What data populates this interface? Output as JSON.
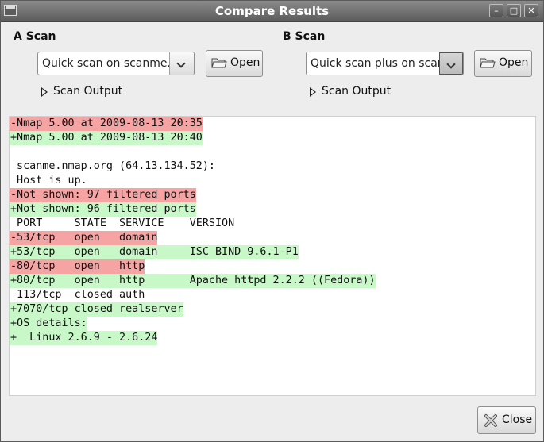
{
  "window": {
    "title": "Compare Results",
    "controls": [
      "minimize",
      "maximize",
      "close"
    ]
  },
  "scan_a": {
    "label": "A Scan",
    "selected": "Quick scan on scanme.i",
    "open_label": "Open",
    "expander_label": "Scan Output"
  },
  "scan_b": {
    "label": "B Scan",
    "selected": "Quick scan plus on scar",
    "open_label": "Open",
    "expander_label": "Scan Output"
  },
  "diff_lines": [
    {
      "text": "-Nmap 5.00 at 2009-08-13 20:35",
      "kind": "del"
    },
    {
      "text": "+Nmap 5.00 at 2009-08-13 20:40",
      "kind": "add"
    },
    {
      "text": "",
      "kind": "same"
    },
    {
      "text": " scanme.nmap.org (64.13.134.52):",
      "kind": "same"
    },
    {
      "text": " Host is up.",
      "kind": "same"
    },
    {
      "text": "-Not shown: 97 filtered ports",
      "kind": "del"
    },
    {
      "text": "+Not shown: 96 filtered ports",
      "kind": "add"
    },
    {
      "text": " PORT     STATE  SERVICE    VERSION",
      "kind": "same"
    },
    {
      "text": "-53/tcp   open   domain",
      "kind": "del"
    },
    {
      "text": "+53/tcp   open   domain     ISC BIND 9.6.1-P1",
      "kind": "add"
    },
    {
      "text": "-80/tcp   open   http",
      "kind": "del"
    },
    {
      "text": "+80/tcp   open   http       Apache httpd 2.2.2 ((Fedora))",
      "kind": "add"
    },
    {
      "text": " 113/tcp  closed auth",
      "kind": "same"
    },
    {
      "text": "+7070/tcp closed realserver",
      "kind": "add"
    },
    {
      "text": "+OS details:",
      "kind": "add"
    },
    {
      "text": "+  Linux 2.6.9 - 2.6.24",
      "kind": "add"
    }
  ],
  "footer": {
    "close_label": "Close"
  },
  "colors": {
    "removed": "#f5a3a3",
    "added": "#c8f7c8",
    "titlebar": "#5c5c5c"
  }
}
